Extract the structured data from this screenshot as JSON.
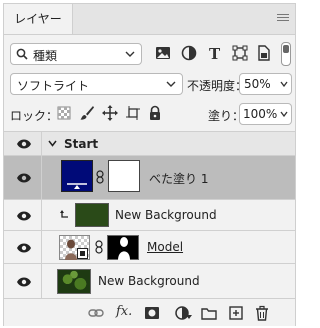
{
  "panel": {
    "tab_label": "レイヤー",
    "menu_icon": "panel-menu-icon"
  },
  "filter": {
    "kind_label": "種類",
    "icons": [
      "image-filter-icon",
      "adjustment-filter-icon",
      "type-filter-icon",
      "shape-filter-icon",
      "smart-object-filter-icon"
    ]
  },
  "blend": {
    "mode": "ソフトライト",
    "opacity_label": "不透明度：",
    "opacity_value": "50%"
  },
  "lock": {
    "label": "ロック：",
    "fill_label": "塗り：",
    "fill_value": "100%"
  },
  "layers": [
    {
      "type": "group",
      "name": "Start",
      "expanded": true
    },
    {
      "type": "fill",
      "name": "べた塗り 1",
      "selected": true,
      "color": "#000a78"
    },
    {
      "type": "clipped",
      "name": "New Background",
      "color": "#2a4a18"
    },
    {
      "type": "smart-mask",
      "name": "Model"
    },
    {
      "type": "image",
      "name": "New Background"
    }
  ],
  "bottom_icons": [
    "link-layers-icon",
    "fx-icon",
    "add-mask-icon",
    "adjustment-layer-icon",
    "new-group-icon",
    "new-layer-icon",
    "delete-icon"
  ],
  "fx_label": "fx."
}
